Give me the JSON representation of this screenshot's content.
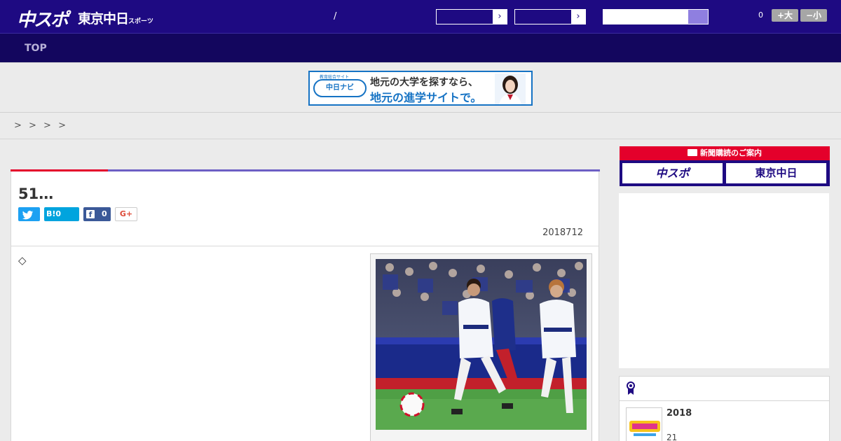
{
  "header": {
    "logo_main": "中スポ",
    "logo_sub": "東京中日",
    "logo_sub_small": "スポーツ",
    "divider": "/",
    "select_arrow": "›",
    "font_count": "0",
    "font_bigger": "+大",
    "font_smaller": "−小"
  },
  "nav": {
    "top_label": "TOP"
  },
  "banner_ad": {
    "logo_top": "教育総合サイト",
    "logo_text": "中日ナビ",
    "line1": "地元の大学を探すなら、",
    "line2": "地元の進学サイトで。"
  },
  "breadcrumb": {
    "text": "> > > >"
  },
  "article": {
    "title": "51…",
    "share_hatena": "B!0",
    "share_facebook_count": "0",
    "share_gplus": "G+",
    "date": "2018712",
    "body_marker": "◇"
  },
  "sidebar": {
    "subscribe_header": "新聞購読のご案内",
    "subscribe_a": "中スポ",
    "subscribe_b": "東京中日",
    "rank_item_title": "2018",
    "rank_item_meta": "21"
  },
  "colors": {
    "header_bg": "#1e0a82",
    "nav_bg": "#13065e",
    "accent_red": "#e4002b",
    "accent_purple": "#6d5fc4",
    "twitter": "#1da1f2",
    "facebook": "#3b5998"
  }
}
